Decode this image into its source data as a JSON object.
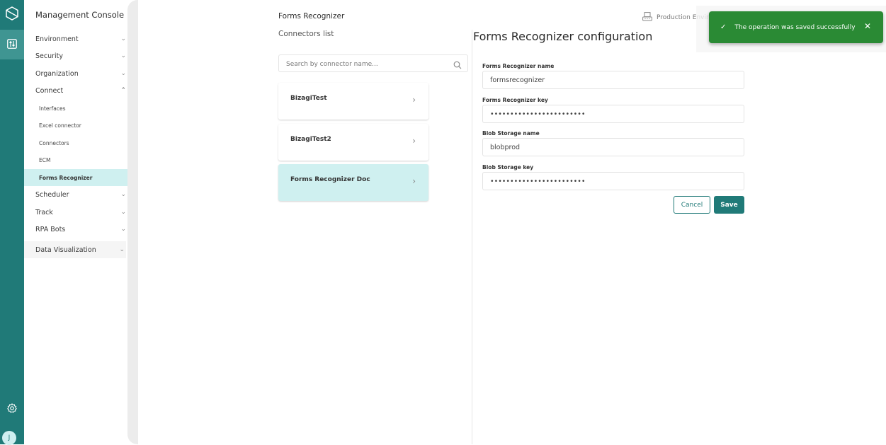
{
  "rail": {
    "logo_icon": "cube-logo-icon",
    "active_item_icon": "sliders-icon",
    "settings_icon": "gear-icon",
    "avatar_initial": "J"
  },
  "menu": {
    "title": "Management Console",
    "items": [
      {
        "label": "Environment",
        "expanded": false
      },
      {
        "label": "Security",
        "expanded": false
      },
      {
        "label": "Organization",
        "expanded": false
      },
      {
        "label": "Connect",
        "expanded": true
      },
      {
        "label": "Scheduler",
        "expanded": false
      },
      {
        "label": "Track",
        "expanded": false
      },
      {
        "label": "RPA Bots",
        "expanded": false
      },
      {
        "label": "Data Visualization",
        "expanded": false
      }
    ],
    "connect_subitems": [
      {
        "label": "Interfaces"
      },
      {
        "label": "Excel connector"
      },
      {
        "label": "Connectors"
      },
      {
        "label": "ECM"
      },
      {
        "label": "Forms Recognizer",
        "active": true
      }
    ]
  },
  "list": {
    "header": "Forms Recognizer",
    "subtitle": "Connectors list",
    "search_placeholder": "Search by connector name...",
    "connectors": [
      {
        "name": "BizagiTest"
      },
      {
        "name": "BizagiTest2"
      },
      {
        "name": "Forms Recognizer Doc",
        "selected": true
      }
    ]
  },
  "config": {
    "title": "Forms Recognizer configuration",
    "fields": [
      {
        "label": "Forms Recognizer name",
        "value": "formsrecognizer",
        "type": "text"
      },
      {
        "label": "Forms Recognizer key",
        "value": "••••••••••••••••••••••••",
        "type": "password"
      },
      {
        "label": "Blob Storage name",
        "value": "blobprod",
        "type": "text"
      },
      {
        "label": "Blob Storage key",
        "value": "••••••••••••••••••••••••",
        "type": "password"
      }
    ],
    "cancel_label": "Cancel",
    "save_label": "Save"
  },
  "environment": {
    "label": "Production Enviro"
  },
  "toast": {
    "message": "The operation was saved successfully",
    "status": "success",
    "color": "#2a8a34"
  },
  "colors": {
    "brand": "#207a78",
    "active_bg": "#cff0f0"
  }
}
